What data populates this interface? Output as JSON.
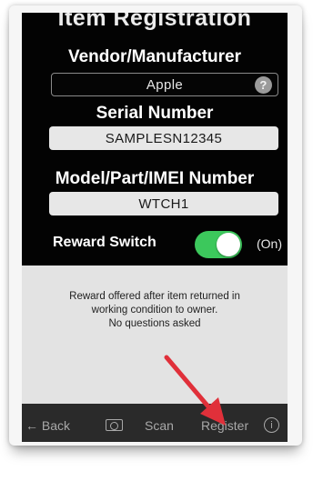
{
  "screen": {
    "title": "Item Registration",
    "vendor": {
      "label": "Vendor/Manufacturer",
      "value": "Apple",
      "help_icon": "?"
    },
    "serial": {
      "label": "Serial Number",
      "value": "SAMPLESN12345"
    },
    "model": {
      "label": "Model/Part/IMEI Number",
      "value": "WTCH1"
    },
    "reward": {
      "label": "Reward Switch",
      "state": "(On)",
      "enabled": true
    },
    "info_lines": [
      "Reward offered after item returned in",
      "working condition to owner.",
      "No questions asked"
    ]
  },
  "toolbar": {
    "back": "← Back",
    "camera_icon": "camera-icon",
    "scan": "Scan",
    "register": "Register",
    "info_icon": "i"
  },
  "annotation": {
    "arrow_color": "#e0303a"
  },
  "colors": {
    "toggle_on": "#3cc85c",
    "screen_bg": "#030303",
    "panel_bg": "#e3e3e3"
  }
}
